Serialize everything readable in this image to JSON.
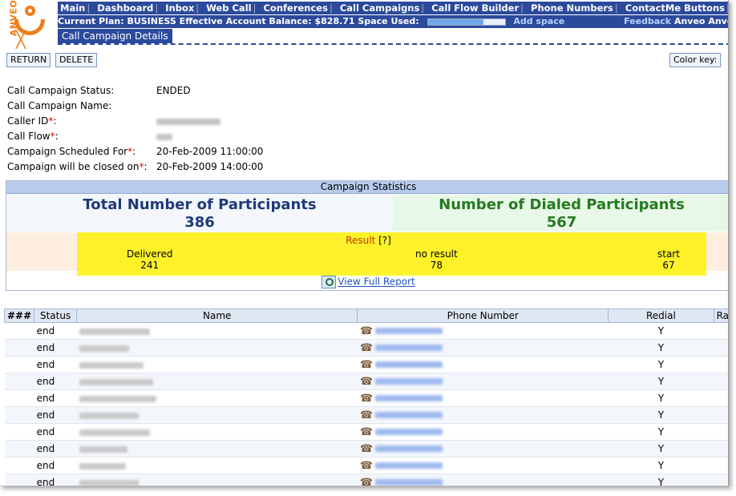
{
  "brand": {
    "logo_text": "ANVEO",
    "logo_color": "#f07d1a",
    "nav_color": "#2c4a9c"
  },
  "nav": {
    "items": [
      "Main",
      "Dashboard",
      "Inbox",
      "Web Call",
      "Conferences",
      "Call Campaigns",
      "Call Flow Builder",
      "Phone Numbers",
      "ContactMe Buttons"
    ]
  },
  "plan": {
    "text": "Current Plan: BUSINESS Effective Account Balance: $828.71 Space Used:",
    "space_used_fraction": 0.72,
    "add_space": "Add space",
    "feedback": "Feedback",
    "anveo": "Anveo Anve"
  },
  "page": {
    "tab_title": "Call Campaign Details"
  },
  "toolbar": {
    "return_label": "RETURN",
    "delete_label": "DELETE",
    "color_key_label": "Color key:"
  },
  "details": {
    "status_label": "Call Campaign Status:",
    "status_value": "ENDED",
    "name_label": "Call Campaign Name:",
    "caller_id_label": "Caller ID",
    "caller_flow_label": "Call Flow",
    "scheduled_label": "Campaign Scheduled For",
    "scheduled_value": "20-Feb-2009 11:00:00",
    "closed_label": "Campaign will be closed on",
    "closed_value": "20-Feb-2009 14:00:00",
    "required_mark": "*",
    "colon": ":"
  },
  "stats": {
    "header": "Campaign Statistics",
    "total_label": "Total Number of Participants",
    "total_value": "386",
    "dialed_label": "Number of Dialed Participants",
    "dialed_value": "567",
    "result_label": "Result",
    "result_help": "[?]",
    "delivered_label": "Delivered",
    "delivered_value": "241",
    "noresult_label": "no result",
    "noresult_value": "78",
    "start_label": "start",
    "start_value": "67",
    "report_link": "View Full Report"
  },
  "table": {
    "headers": [
      "###",
      "Status",
      "Name",
      "Phone Number",
      "Redial",
      "Ra"
    ],
    "rows": [
      {
        "status": "end",
        "redial": "Y"
      },
      {
        "status": "end",
        "redial": "Y"
      },
      {
        "status": "end",
        "redial": "Y"
      },
      {
        "status": "end",
        "redial": "Y"
      },
      {
        "status": "end",
        "redial": "Y"
      },
      {
        "status": "end",
        "redial": "Y"
      },
      {
        "status": "end",
        "redial": "Y"
      },
      {
        "status": "end",
        "redial": "Y"
      },
      {
        "status": "end",
        "redial": "Y"
      },
      {
        "status": "end",
        "redial": "Y"
      }
    ]
  }
}
